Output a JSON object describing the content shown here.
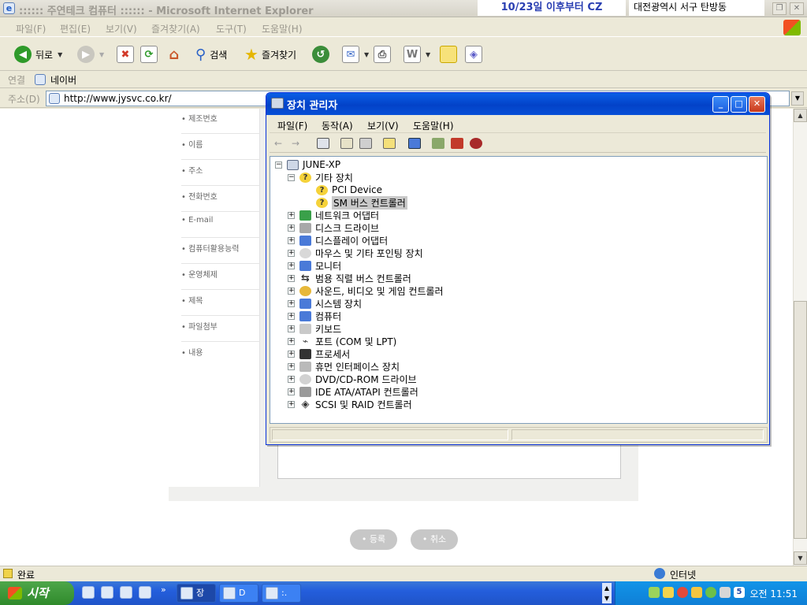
{
  "browser": {
    "title": ":::::: 주연테크 컴퓨터 :::::: - Microsoft Internet Explorer",
    "ticker_text": "10/23일 이후부터 CZ",
    "location_text": "대전광역시 서구 탄방동",
    "menu": [
      "파일(F)",
      "편집(E)",
      "보기(V)",
      "즐겨찾기(A)",
      "도구(T)",
      "도움말(H)"
    ],
    "toolbar": {
      "back_label": "뒤로",
      "search_label": "검색",
      "favorites_label": "즐겨찾기"
    },
    "links_label": "연결",
    "link_naver": "네이버",
    "address_label": "주소(D)",
    "address_value": "http://www.jysvc.co.kr/",
    "status_text": "완료",
    "zone_text": "인터넷"
  },
  "webpage": {
    "form_labels": [
      "• 제조번호",
      "• 이름",
      "• 주소",
      "• 전화번호",
      "• E-mail",
      "• 컴퓨터활용능력",
      "• 운영체제",
      "• 제목",
      "• 파일첨부",
      "• 내용"
    ],
    "submit_label": "• 등록",
    "cancel_label": "• 취소"
  },
  "device_manager": {
    "title": "장치 관리자",
    "menu": [
      "파일(F)",
      "동작(A)",
      "보기(V)",
      "도움말(H)"
    ],
    "computer_name": "JUNE-XP",
    "other_devices": {
      "label": "기타 장치",
      "children": [
        "PCI Device",
        "SM 버스 컨트롤러"
      ]
    },
    "categories": [
      "네트워크 어댑터",
      "디스크 드라이브",
      "디스플레이 어댑터",
      "마우스 및 기타 포인팅 장치",
      "모니터",
      "범용 직렬 버스 컨트롤러",
      "사운드, 비디오 및 게임 컨트롤러",
      "시스템 장치",
      "컴퓨터",
      "키보드",
      "포트 (COM 및 LPT)",
      "프로세서",
      "휴먼 인터페이스 장치",
      "DVD/CD-ROM 드라이브",
      "IDE ATA/ATAPI 컨트롤러",
      "SCSI 및 RAID 컨트롤러"
    ]
  },
  "taskbar": {
    "start_label": "시작",
    "tasks": [
      "장",
      "D",
      ":."
    ],
    "clock": "오전 11:51",
    "tray_badge": "5"
  },
  "colors": {
    "xp_blue": "#0a5fe6",
    "start_green": "#3c9a38",
    "ticker_blue": "#2a3fb2"
  }
}
